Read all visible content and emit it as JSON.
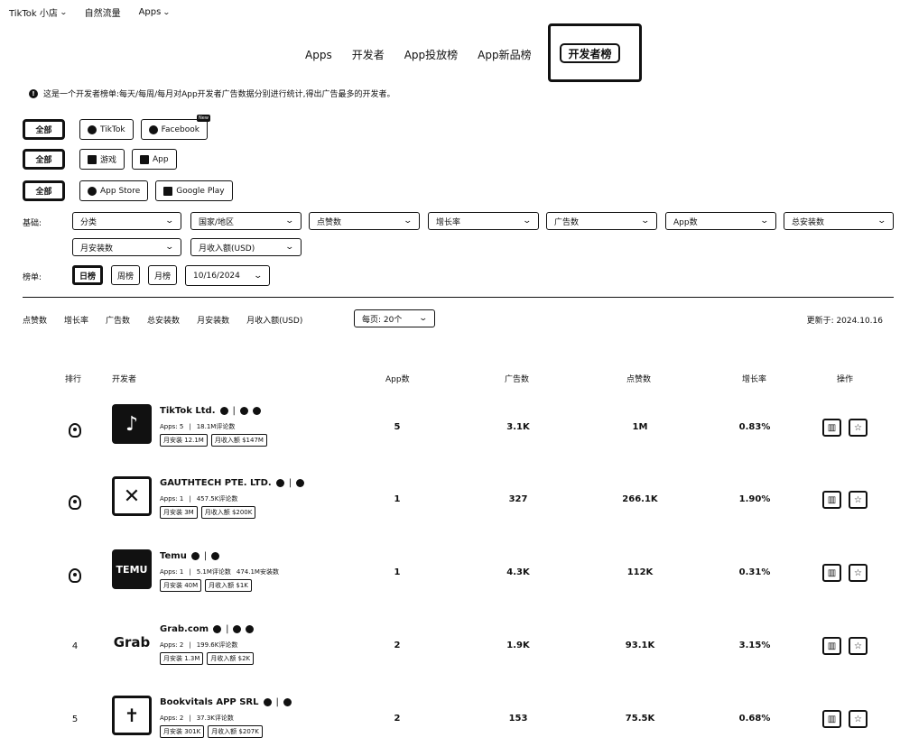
{
  "topbar": {
    "shop": "TikTok 小店",
    "traffic": "自然流量",
    "apps": "Apps"
  },
  "tabs": [
    "Apps",
    "开发者",
    "App投放榜",
    "App新品榜"
  ],
  "active_tab": "开发者榜",
  "info": "这是一个开发者榜单:每天/每周/每月对App开发者广告数据分别进行统计,得出广告最多的开发者。",
  "platform_row": {
    "all": "全部",
    "options": [
      "TikTok",
      "Facebook"
    ],
    "new_badge": "New"
  },
  "type_row": {
    "all": "全部",
    "options": [
      "游戏",
      "App"
    ]
  },
  "store_row": {
    "all": "全部",
    "options": [
      "App Store",
      "Google Play"
    ]
  },
  "basic": {
    "label": "基础:",
    "selects": [
      "分类",
      "国家/地区",
      "点赞数",
      "增长率",
      "广告数",
      "App数",
      "总安装数"
    ],
    "selects2": [
      "月安装数",
      "月收入额(USD)"
    ]
  },
  "ranking": {
    "label": "榜单:",
    "buttons": [
      "日榜",
      "周榜",
      "月榜"
    ],
    "date": "10/16/2024"
  },
  "sort": {
    "options": [
      "点赞数",
      "增长率",
      "广告数",
      "总安装数",
      "月安装数",
      "月收入额(USD)"
    ],
    "per_page": "每页: 20个",
    "updated": "更新于: 2024.10.16"
  },
  "table": {
    "headers": [
      "排行",
      "开发者",
      "App数",
      "广告数",
      "点赞数",
      "增长率",
      "操作"
    ],
    "rows": [
      {
        "rank": "1",
        "name": "TikTok Ltd.",
        "logo": "♪",
        "meta": [
          "Apps: 5",
          "18.1M评论数"
        ],
        "tags": [
          "月安装 12.1M",
          "月收入额 $147M"
        ],
        "apps": "5",
        "ads": "3.1K",
        "likes": "1M",
        "growth": "0.83%"
      },
      {
        "rank": "2",
        "name": "GAUTHTECH PTE. LTD.",
        "logo": "✕",
        "meta": [
          "Apps: 1",
          "457.5K评论数"
        ],
        "tags": [
          "月安装 3M",
          "月收入额 $200K"
        ],
        "apps": "1",
        "ads": "327",
        "likes": "266.1K",
        "growth": "1.90%"
      },
      {
        "rank": "3",
        "name": "Temu",
        "logo": "TEMU",
        "meta": [
          "Apps: 1",
          "5.1M评论数",
          "474.1M安装数"
        ],
        "tags": [
          "月安装 40M",
          "月收入额 $1K"
        ],
        "apps": "1",
        "ads": "4.3K",
        "likes": "112K",
        "growth": "0.31%"
      },
      {
        "rank": "4",
        "name": "Grab.com",
        "logo": "Grab",
        "meta": [
          "Apps: 2",
          "199.6K评论数"
        ],
        "tags": [
          "月安装 1.3M",
          "月收入额 $2K"
        ],
        "apps": "2",
        "ads": "1.9K",
        "likes": "93.1K",
        "growth": "3.15%"
      },
      {
        "rank": "5",
        "name": "Bookvitals APP SRL",
        "logo": "✝",
        "meta": [
          "Apps: 2",
          "37.3K评论数"
        ],
        "tags": [
          "月安装 301K",
          "月收入额 $207K"
        ],
        "apps": "2",
        "ads": "153",
        "likes": "75.5K",
        "growth": "0.68%"
      }
    ]
  }
}
